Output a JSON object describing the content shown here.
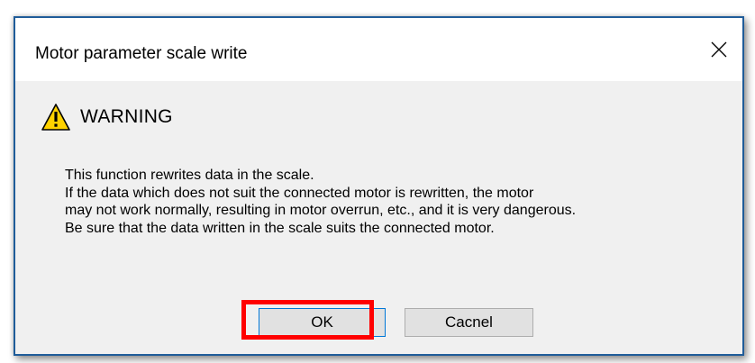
{
  "dialog": {
    "title": "Motor parameter scale write",
    "close_icon": "close-icon",
    "warning": {
      "icon": "warning-triangle-icon",
      "icon_color": "#ffd200",
      "heading": "WARNING"
    },
    "message_lines": [
      "This function rewrites data in the scale.",
      "If the data which does not suit the connected motor is rewritten, the motor",
      "may not work normally, resulting in motor overrun, etc., and it is very dangerous.",
      "Be sure that the data written in the scale suits the connected motor."
    ],
    "buttons": {
      "ok_label": "OK",
      "cancel_label": "Cacnel"
    }
  },
  "annotation": {
    "highlight_color": "#ff0000",
    "highlight_target": "OK"
  }
}
